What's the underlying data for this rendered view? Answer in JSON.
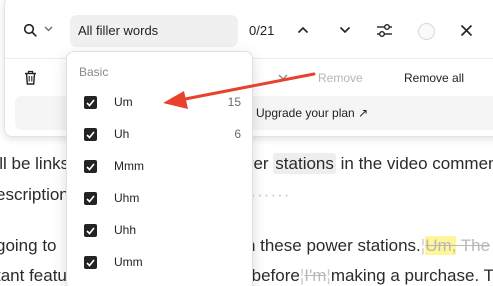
{
  "search": {
    "filter_value": "All filler words",
    "counter": "0/21"
  },
  "actions": {
    "remove": "Remove",
    "remove_all": "Remove all",
    "upgrade": "Upgrade your plan ↗"
  },
  "dropdown": {
    "group_label": "Basic",
    "options": [
      {
        "label": "Um",
        "count": "15",
        "checked": true
      },
      {
        "label": "Uh",
        "count": "6",
        "checked": true
      },
      {
        "label": "Mmm",
        "count": "",
        "checked": true
      },
      {
        "label": "Uhm",
        "count": "",
        "checked": true
      },
      {
        "label": "Uhh",
        "count": "",
        "checked": true
      },
      {
        "label": "Umm",
        "count": "",
        "checked": true
      }
    ]
  },
  "document": {
    "line1_a": "'ll be links",
    "line1_b": "wer ",
    "line1_stations": "stations",
    "line1_c": " in the video commen",
    "line2_a": "escription",
    "line2_dots": "·······",
    "line3_a": " going to",
    "line3_b": "on these power stations.",
    "line3_um": "Um,",
    "line3_the": " The",
    "line4_a": "tant featu",
    "line4_b": " before",
    "line4_um": "I'm",
    "line4_c": "making a purchase. T"
  },
  "colors": {
    "highlight": "#fff59a",
    "arrow": "#e8412c",
    "checkbox": "#232323"
  },
  "icons": [
    "search-icon",
    "chevron-down-icon",
    "chevron-up-icon",
    "sliders-icon",
    "close-icon",
    "trash-icon",
    "arrow-annotation"
  ]
}
